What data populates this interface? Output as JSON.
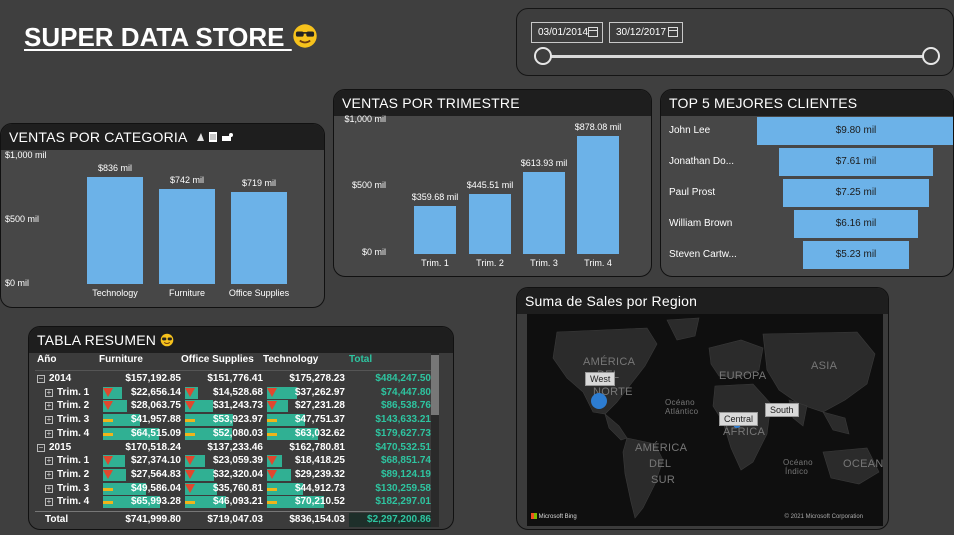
{
  "title": "SUPER DATA STORE",
  "date_slicer": {
    "start": "03/01/2014",
    "end": "30/12/2017"
  },
  "ventas_categoria": {
    "title": "VENTAS POR CATEGORIA",
    "chart_data": {
      "type": "bar",
      "categories": [
        "Technology",
        "Furniture",
        "Office Supplies"
      ],
      "values": [
        836,
        742,
        719
      ],
      "value_labels": [
        "$836 mil",
        "$742 mil",
        "$719 mil"
      ],
      "yticks": [
        "$1,000 mil",
        "$500 mil",
        "$0 mil"
      ],
      "ylim": [
        0,
        1000
      ]
    }
  },
  "ventas_trimestre": {
    "title": "VENTAS POR TRIMESTRE",
    "chart_data": {
      "type": "bar",
      "categories": [
        "Trim. 1",
        "Trim. 2",
        "Trim. 3",
        "Trim. 4"
      ],
      "values": [
        359.68,
        445.51,
        613.93,
        878.08
      ],
      "value_labels": [
        "$359.68 mil",
        "$445.51 mil",
        "$613.93 mil",
        "$878.08 mil"
      ],
      "yticks": [
        "$1,000 mil",
        "$500 mil",
        "$0 mil"
      ],
      "ylim": [
        0,
        1000
      ]
    }
  },
  "top5": {
    "title": "TOP 5 MEJORES CLIENTES",
    "chart_data": {
      "type": "bar",
      "categories": [
        "John Lee",
        "Jonathan Do...",
        "Paul Prost",
        "William Brown",
        "Steven Cartw..."
      ],
      "values": [
        9.8,
        7.61,
        7.25,
        6.16,
        5.23
      ],
      "value_labels": [
        "$9.80 mil",
        "$7.61 mil",
        "$7.25 mil",
        "$6.16 mil",
        "$5.23 mil"
      ]
    }
  },
  "tabla": {
    "title": "TABLA RESUMEN",
    "headers": [
      "Año",
      "Furniture",
      "Office Supplies",
      "Technology",
      "Total"
    ],
    "rows": [
      {
        "label": "2014",
        "kind": "year",
        "f": "$157,192.85",
        "o": "$151,776.41",
        "t": "$175,278.23",
        "tot": "$484,247.50"
      },
      {
        "label": "Trim. 1",
        "kind": "q",
        "f": "$22,656.14",
        "o": "$14,528.68",
        "t": "$37,262.97",
        "tot": "$74,447.80",
        "fb": 0.25,
        "ob": 0.17,
        "tb": 0.4,
        "fi": "down",
        "oi": "down",
        "ti": "down"
      },
      {
        "label": "Trim. 2",
        "kind": "q",
        "f": "$28,063.75",
        "o": "$31,243.73",
        "t": "$27,231.28",
        "tot": "$86,538.76",
        "fb": 0.32,
        "ob": 0.38,
        "tb": 0.28,
        "fi": "down",
        "oi": "down",
        "ti": "down"
      },
      {
        "label": "Trim. 3",
        "kind": "q",
        "f": "$41,957.88",
        "o": "$53,923.97",
        "t": "$47,751.37",
        "tot": "$143,633.21",
        "fb": 0.5,
        "ob": 0.65,
        "tb": 0.52,
        "fi": "flat",
        "oi": "flat",
        "ti": "flat"
      },
      {
        "label": "Trim. 4",
        "kind": "q",
        "f": "$64,515.09",
        "o": "$52,080.03",
        "t": "$63,032.62",
        "tot": "$179,627.73",
        "fb": 0.75,
        "ob": 0.63,
        "tb": 0.69,
        "fi": "flat",
        "oi": "flat",
        "ti": "flat"
      },
      {
        "label": "2015",
        "kind": "year",
        "f": "$170,518.24",
        "o": "$137,233.46",
        "t": "$162,780.81",
        "tot": "$470,532.51"
      },
      {
        "label": "Trim. 1",
        "kind": "q",
        "f": "$27,374.10",
        "o": "$23,059.39",
        "t": "$18,418.25",
        "tot": "$68,851.74",
        "fb": 0.3,
        "ob": 0.27,
        "tb": 0.2,
        "fi": "down",
        "oi": "down",
        "ti": "down"
      },
      {
        "label": "Trim. 2",
        "kind": "q",
        "f": "$27,564.83",
        "o": "$32,320.04",
        "t": "$29,239.32",
        "tot": "$89,124.19",
        "fb": 0.31,
        "ob": 0.39,
        "tb": 0.32,
        "fi": "down",
        "oi": "down",
        "ti": "down"
      },
      {
        "label": "Trim. 3",
        "kind": "q",
        "f": "$49,586.04",
        "o": "$35,760.81",
        "t": "$44,912.73",
        "tot": "$130,259.58",
        "fb": 0.58,
        "ob": 0.43,
        "tb": 0.49,
        "fi": "flat",
        "oi": "down",
        "ti": "flat"
      },
      {
        "label": "Trim. 4",
        "kind": "q",
        "f": "$65,993.28",
        "o": "$46,093.21",
        "t": "$70,210.52",
        "tot": "$182,297.01",
        "fb": 0.77,
        "ob": 0.56,
        "tb": 0.77,
        "fi": "flat",
        "oi": "flat",
        "ti": "flat"
      }
    ],
    "total": {
      "label": "Total",
      "f": "$741,999.80",
      "o": "$719,047.03",
      "t": "$836,154.03",
      "tot": "$2,297,200.86"
    }
  },
  "mapa": {
    "title": "Suma de Sales por Region",
    "regions": [
      "West",
      "Central",
      "South"
    ],
    "labels": [
      "AMÉRICA",
      "DEL",
      "NORTE",
      "EUROPA",
      "ASIA",
      "ÁFRICA",
      "AMÉRICA",
      "DEL",
      "SUR",
      "OCEAN",
      "Océano",
      "Atlántico",
      "Océano",
      "Índico"
    ],
    "attribution": "© 2021 Microsoft Corporation",
    "bing": "Microsoft Bing"
  }
}
